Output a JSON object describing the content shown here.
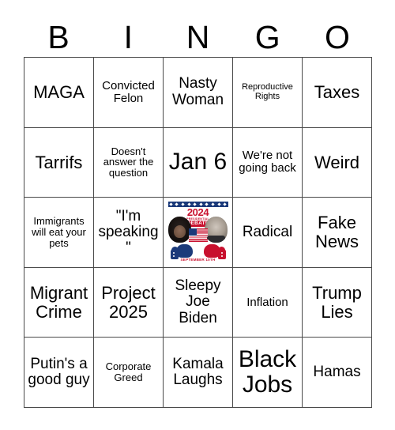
{
  "card": {
    "header_letters": [
      "B",
      "I",
      "N",
      "G",
      "O"
    ],
    "rows": [
      [
        {
          "text": "MAGA",
          "size": "lg"
        },
        {
          "text": "Convicted Felon",
          "size": "sm"
        },
        {
          "text": "Nasty Woman",
          "size": "md"
        },
        {
          "text": "Reproductive Rights",
          "size": "xxs"
        },
        {
          "text": "Taxes",
          "size": "lg"
        }
      ],
      [
        {
          "text": "Tarrifs",
          "size": "lg"
        },
        {
          "text": "Doesn't answer the question",
          "size": "xs"
        },
        {
          "text": "Jan 6",
          "size": "xl"
        },
        {
          "text": "We're not going back",
          "size": "sm"
        },
        {
          "text": "Weird",
          "size": "lg"
        }
      ],
      [
        {
          "text": "Immigrants will eat your pets",
          "size": "xs"
        },
        {
          "text": "\"I'm speaking\"",
          "size": "md"
        },
        {
          "text": "",
          "size": "free",
          "free_space": true
        },
        {
          "text": "Radical",
          "size": "md"
        },
        {
          "text": "Fake News",
          "size": "lg"
        }
      ],
      [
        {
          "text": "Migrant Crime",
          "size": "lg"
        },
        {
          "text": "Project 2025",
          "size": "lg"
        },
        {
          "text": "Sleepy Joe Biden",
          "size": "md"
        },
        {
          "text": "Inflation",
          "size": "sm"
        },
        {
          "text": "Trump Lies",
          "size": "lg"
        }
      ],
      [
        {
          "text": "Putin's a good guy",
          "size": "md"
        },
        {
          "text": "Corporate Greed",
          "size": "xs"
        },
        {
          "text": "Kamala Laughs",
          "size": "md"
        },
        {
          "text": "Black Jobs",
          "size": "xl"
        },
        {
          "text": "Hamas",
          "size": "md"
        }
      ]
    ]
  },
  "free_space_image": {
    "name": "2024-presidential-debate-graphic",
    "year": "2024",
    "presidential_label": "PRESIDENTIAL",
    "debate_label": "DEBATE",
    "date_label": "SEPTEMBER 10TH",
    "left_portrait": "kamala-harris-portrait",
    "right_portrait": "donald-trump-portrait",
    "flag": "us-flag",
    "left_glove": "blue-boxing-glove",
    "right_glove": "red-boxing-glove",
    "colors": {
      "red": "#c8102e",
      "blue": "#1b3a7a",
      "white": "#ffffff"
    }
  },
  "style": {
    "border_color": "#4a4a4a",
    "background": "#ffffff",
    "text_color": "#000000"
  }
}
